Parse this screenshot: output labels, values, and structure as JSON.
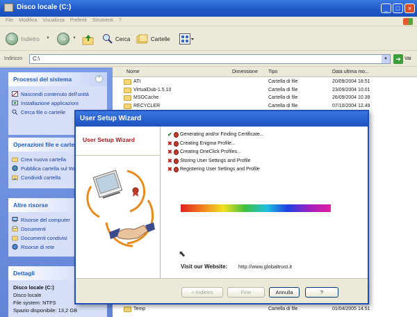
{
  "window": {
    "title": "Disco locale (C:)",
    "controls": [
      "_",
      "□",
      "×"
    ]
  },
  "menu": [
    "File",
    "Modifica",
    "Visualizza",
    "Preferiti",
    "Strumenti",
    "?"
  ],
  "toolbar": {
    "back": "Indietro",
    "search": "Cerca",
    "folders": "Cartelle"
  },
  "address": {
    "label": "Indirizzo",
    "value": "C:\\",
    "go": "Vai"
  },
  "taskpane": {
    "system": {
      "title": "Processi del sistema",
      "items": [
        "Nascondi contenuto dell'unità",
        "Installazione applicazioni",
        "Cerca file o cartelle"
      ]
    },
    "fileops": {
      "title": "Operazioni file e cartelle",
      "items": [
        "Crea nuova cartella",
        "Pubblica cartella sul Web",
        "Condividi cartella"
      ]
    },
    "other": {
      "title": "Altre risorse",
      "items": [
        "Risorse del computer",
        "Documenti",
        "Documenti condivisi",
        "Risorse di rete"
      ]
    },
    "details": {
      "title": "Dettagli",
      "name": "Disco locale (C:)",
      "type": "Disco locale",
      "fs": "File system: NTFS",
      "free": "Spazio disponibile: 13,2 GB"
    }
  },
  "filelist": {
    "columns": [
      "Nome",
      "Dimensione",
      "Tipo",
      "Data ultima mo..."
    ],
    "rows": [
      {
        "name": "ATI",
        "type": "Cartella di file",
        "date": "20/09/2004 18.51"
      },
      {
        "name": "VirtualDub-1.5.10",
        "type": "Cartella di file",
        "date": "23/09/2004 10.01"
      },
      {
        "name": "MSOCache",
        "type": "Cartella di file",
        "date": "26/09/2004 10.39"
      },
      {
        "name": "RECYCLER",
        "type": "Cartella di file",
        "date": "07/10/2004 12.49"
      },
      {
        "name": "",
        "type": "",
        "date": "04 21.42"
      },
      {
        "name": "",
        "type": "",
        "date": "04 8.08"
      },
      {
        "name": "",
        "type": "",
        "date": "04 12.00"
      },
      {
        "name": "",
        "type": "",
        "date": "04 9.41"
      },
      {
        "name": "",
        "type": "",
        "date": "04 10.59"
      },
      {
        "name": "",
        "type": "",
        "date": "04 11.07"
      },
      {
        "name": "",
        "type": "",
        "date": "04 14.57"
      },
      {
        "name": "",
        "type": "",
        "date": "04 15.09"
      },
      {
        "name": "",
        "type": "",
        "date": "04 20.11"
      },
      {
        "name": "",
        "type": "",
        "date": "04 14.30"
      },
      {
        "name": "",
        "type": "",
        "date": "05 12.25"
      },
      {
        "name": "",
        "type": "",
        "date": "05 16.39"
      },
      {
        "name": "",
        "type": "",
        "date": "05 10.39"
      },
      {
        "name": "",
        "type": "",
        "date": "05 11.51"
      },
      {
        "name": "",
        "type": "",
        "date": "05 16.04"
      },
      {
        "name": "",
        "type": "",
        "date": "05 16.20"
      },
      {
        "name": "",
        "type": "",
        "date": "05 16.34"
      },
      {
        "name": "",
        "type": "",
        "date": "05 13.43"
      },
      {
        "name": "",
        "type": "",
        "date": "05 10.39"
      },
      {
        "name": "",
        "type": "",
        "date": "05 14.57"
      },
      {
        "name": "",
        "type": "",
        "date": "05 17.56"
      },
      {
        "name": "",
        "type": "",
        "date": "05 12.03"
      },
      {
        "name": "",
        "type": "",
        "date": "05 16.39"
      },
      {
        "name": "Temp",
        "type": "Cartella di file",
        "date": "01/04/2005 14.51"
      }
    ]
  },
  "wizard": {
    "title": "User Setup Wizard",
    "side_label": "User Setup Wizard",
    "steps": [
      {
        "mark": "✔",
        "color": "#2a7a2a",
        "label": "Generating and/or Finding Certificate..."
      },
      {
        "mark": "✖",
        "color": "#c0201a",
        "label": "Creating Enigma Profile..."
      },
      {
        "mark": "✖",
        "color": "#c0201a",
        "label": "Creating OneClick Profiles..."
      },
      {
        "mark": "✖",
        "color": "#c0201a",
        "label": "Storing User Settings and Profile"
      },
      {
        "mark": "✖",
        "color": "#c0201a",
        "label": "Registering User Settings and Profile"
      }
    ],
    "website_label": "Visit our Website:",
    "website_url": "http://www.globaltrust.it",
    "buttons": {
      "back": "< Indietro",
      "next": "Fine",
      "cancel": "Annulla",
      "help": "?"
    }
  }
}
